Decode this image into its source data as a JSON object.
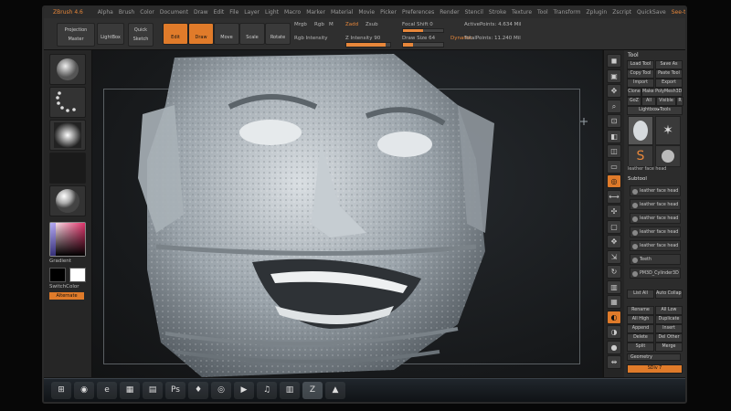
{
  "menubar": {
    "app_title": "ZBrush 4.6",
    "items": [
      "Alpha",
      "Brush",
      "Color",
      "Document",
      "Draw",
      "Edit",
      "File",
      "Layer",
      "Light",
      "Macro",
      "Marker",
      "Material",
      "Movie",
      "Picker",
      "Preferences",
      "Render",
      "Stencil",
      "Stroke",
      "Texture",
      "Tool",
      "Transform",
      "Zplugin",
      "Zscript"
    ],
    "right": [
      "QuickSave",
      "See-through",
      "Menus",
      "DefaultZScript"
    ]
  },
  "shelf": {
    "projection": "Projection Master",
    "lightbox": "LightBox",
    "quick_sketch": "Quick Sketch",
    "edit": "Edit",
    "draw": "Draw",
    "move": "Move",
    "scale": "Scale",
    "rotate": "Rotate",
    "mrgb": "Mrgb",
    "rgb": "Rgb",
    "m": "M",
    "zadd": "Zadd",
    "zsub": "Zsub",
    "rgb_intensity": "Rgb Intensity",
    "z_intensity": "Z Intensity 90",
    "focal_shift": "Focal Shift 0",
    "draw_size": "Draw Size 64",
    "active_points": "ActivePoints: 4.634 Mil",
    "total_points": "TotalPoints: 11.240 Mil",
    "dynamic": "Dynamic"
  },
  "left_tray": {
    "gradient": "Gradient",
    "switch_color": "SwitchColor",
    "alternate": "Alternate"
  },
  "right_bar": [
    "BPR",
    "SPix 3",
    "Scroll",
    "Zoom",
    "Actual",
    "AAHalf",
    "Persp",
    "Floor",
    "Local",
    "LSym",
    "Xyz",
    "Frame",
    "Move",
    "Scale",
    "Rotate",
    "Line Fill",
    "PolyF",
    "Transp",
    "Ghost",
    "Solo",
    "Xpose"
  ],
  "palette": {
    "title": "Tool",
    "load_tool": "Load Tool",
    "save_as": "Save As",
    "copy_tool": "Copy Tool",
    "paste_tool": "Paste Tool",
    "import": "Import",
    "export": "Export",
    "clone": "Clone",
    "make_polymesh": "Make PolyMesh3D",
    "goz": "GoZ",
    "all": "All",
    "visible": "Visible",
    "r": "R",
    "lightbox_tools": "Lightbox▸Tools",
    "current_tool": "leather face head",
    "subtool_title": "Subtool",
    "subtools": [
      "leather face head",
      "leather face head",
      "leather face head",
      "leather face head",
      "leather face head",
      "Teeth",
      "PM3D_Cylinder3D"
    ],
    "list_all": "List All",
    "auto_collapse": "Auto Collapse",
    "rename": "Rename",
    "all_low": "All Low",
    "all_high": "All High",
    "duplicate": "Duplicate",
    "append": "Append",
    "insert": "Insert",
    "delete": "Delete",
    "del_other": "Del Other",
    "split": "Split",
    "merge": "Merge",
    "geometry": "Geometry",
    "sdiv": "SDiv 7"
  },
  "taskbar": {
    "items": [
      "start-icon",
      "firefox-icon",
      "ie-icon",
      "explorer-icon",
      "folder-icon",
      "photoshop-icon",
      "hardware-icon",
      "chrome-icon",
      "media-icon",
      "itunes-icon",
      "calculator-icon",
      "zbrush-icon",
      "sketchup-icon"
    ],
    "glyphs": [
      "⊞",
      "◉",
      "e",
      "▦",
      "▤",
      "Ps",
      "♦",
      "◎",
      "▶",
      "♫",
      "▥",
      "Z",
      "▲"
    ]
  },
  "colors": {
    "accent": "#e8873a",
    "panel": "#2c2c2c",
    "canvas": "#1c1f22"
  }
}
